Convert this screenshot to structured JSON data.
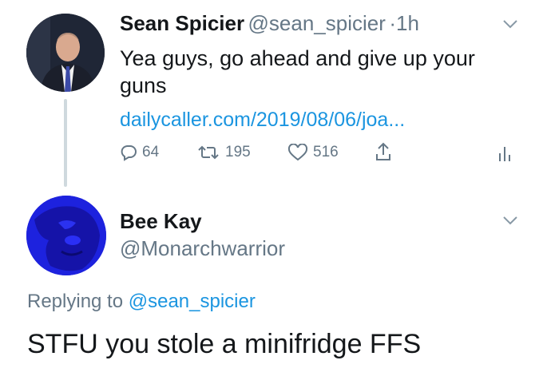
{
  "tweet": {
    "display_name": "Sean Spicier",
    "handle": "@sean_spicier",
    "separator": "·",
    "time": "1h",
    "text_line1": "Yea guys, go ahead and give up your",
    "text_line2": "guns",
    "link": "dailycaller.com/2019/08/06/joa...",
    "replies": "64",
    "retweets": "195",
    "likes": "516"
  },
  "reply": {
    "display_name": "Bee Kay",
    "handle": "@Monarchwarrior",
    "replying_prefix": "Replying to",
    "replying_to": "@sean_spicier",
    "text": "STFU you stole a minifridge FFS"
  },
  "colors": {
    "link": "#1b95e0",
    "muted": "#657786",
    "avatar2": "#1a1fd6"
  },
  "icons": [
    "chevron-down-icon",
    "reply-icon",
    "retweet-icon",
    "like-icon",
    "share-icon",
    "analytics-icon"
  ]
}
